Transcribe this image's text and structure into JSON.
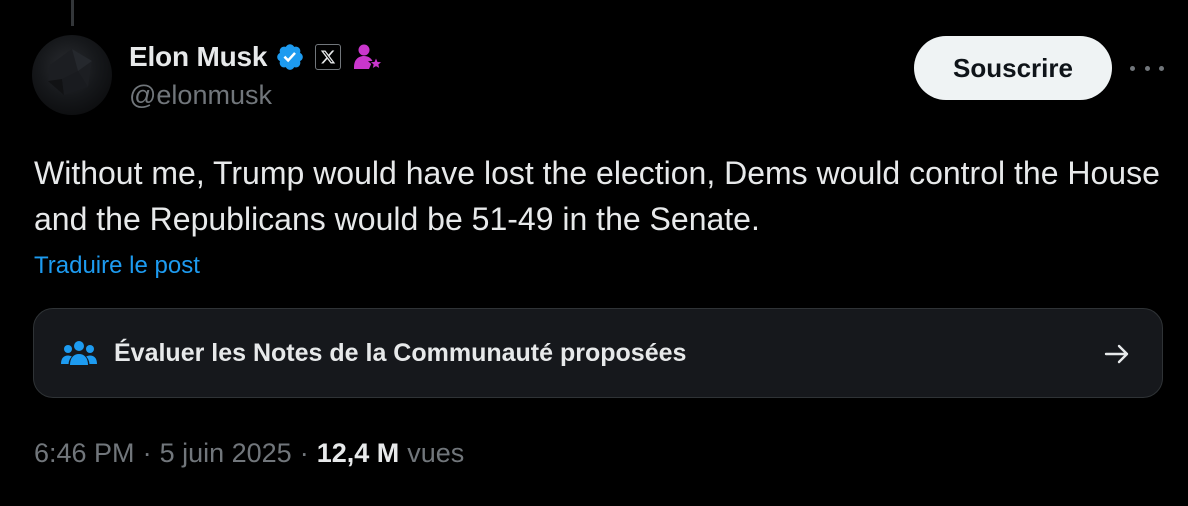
{
  "author": {
    "display_name": "Elon Musk",
    "handle": "@elonmusk",
    "verified_icon": "verified-badge-icon",
    "org_badge_icon": "x-logo-icon",
    "affiliate_icon": "user-star-icon"
  },
  "actions": {
    "subscribe_label": "Souscrire",
    "more_icon": "more-horizontal-icon"
  },
  "tweet": {
    "text": "Without me, Trump would have lost the election, Dems would control the House and the Republicans would be 51-49 in the Senate.",
    "translate_label": "Traduire le post"
  },
  "community_notes": {
    "label": "Évaluer les Notes de la Communauté proposées",
    "icon": "people-icon",
    "arrow_icon": "arrow-right-icon"
  },
  "meta": {
    "time": "6:46 PM",
    "separator": "·",
    "date": "5 juin 2025",
    "views_count": "12,4 M",
    "views_label": "vues"
  },
  "colors": {
    "background": "#000000",
    "text_primary": "#e7e9ea",
    "text_secondary": "#71767b",
    "link": "#1d9bf0",
    "verified": "#1d9bf0",
    "affiliate": "#c936cc",
    "button_bg": "#eff3f4"
  }
}
